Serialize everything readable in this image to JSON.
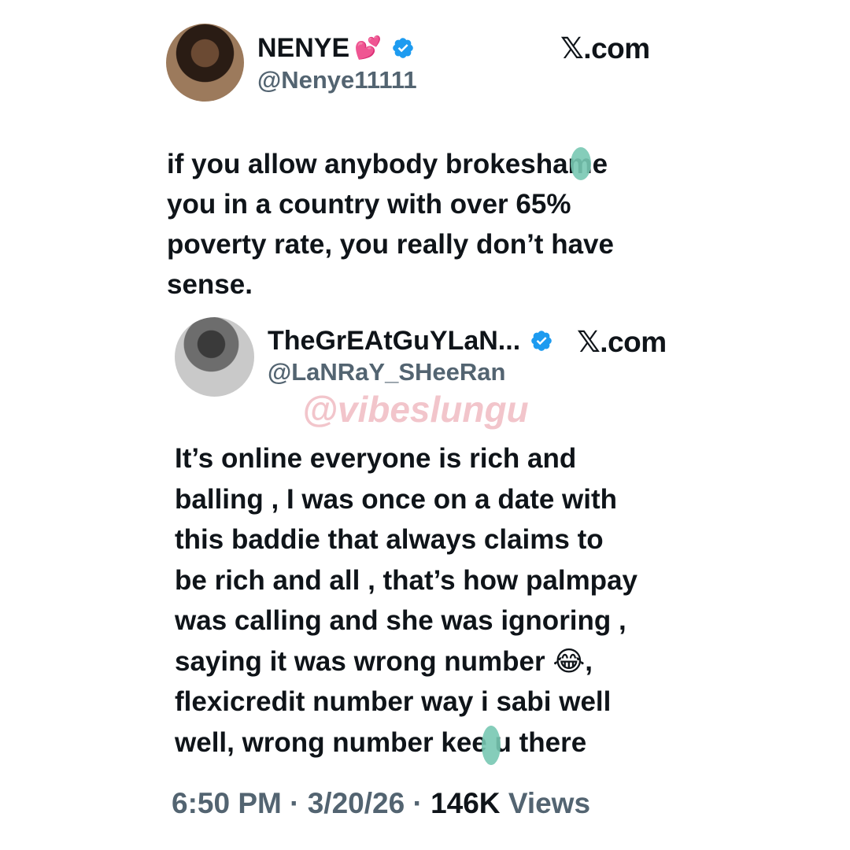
{
  "brand": {
    "x_accent": "#0f1419",
    "verified_blue": "#1d9bf0",
    "muted": "#536471",
    "watermark_color": "#e7969f"
  },
  "main_tweet": {
    "display_name": "NENYE",
    "name_emoji": "💕",
    "handle": "@Nenye11111",
    "source": "𝕏.com",
    "avatar_icon": "user-avatar",
    "body_lines": [
      "if you allow anybody brokeshame",
      "you in a country with over 65%",
      "poverty rate, you really don’t have",
      "sense."
    ]
  },
  "quoted_tweet": {
    "display_name": "TheGrEAtGuYLaN...",
    "handle": "@LaNRaY_SHeeRan",
    "source": "𝕏.com",
    "avatar_icon": "user-avatar",
    "body_lines": [
      "It’s online everyone is rich and",
      "balling , I was once on a date with",
      "this baddie that always claims to",
      "be rich and all , that’s how palmpay",
      "was calling and she was ignoring ,",
      "saying it was wrong number 😂,",
      "flexicredit number way i sabi well",
      "well, wrong number kee u there"
    ]
  },
  "watermark": "@vibeslungu",
  "meta": {
    "time": "6:50 PM",
    "date": "3/20/26",
    "views_count": "146K",
    "views_label": "Views",
    "separator": "·"
  }
}
